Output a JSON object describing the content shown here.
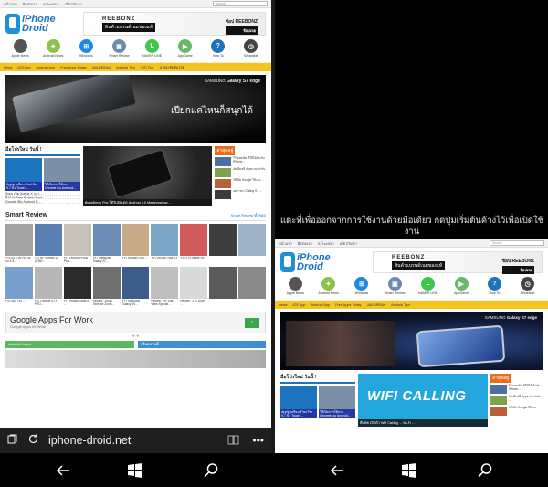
{
  "left_page": {
    "topbar": {
      "links": [
        "หน้าแรก",
        "ติดต่อเรา",
        "ลงโฆษณา",
        "เกี่ยวกับเรา"
      ],
      "search_placeholder": "Search"
    },
    "logo": {
      "line1": "iPhone",
      "line2": "Droid"
    },
    "banner": {
      "brand": "REEBONZ",
      "tagline": "สินค้าแบรนด์เนมของแท้",
      "cta_top": "ช้อป REEBONZ",
      "cta_bottom": "ช้อปเลย"
    },
    "categories": [
      {
        "label": "Apple News",
        "glyph": "",
        "color": "#555555"
      },
      {
        "label": "Android News",
        "glyph": "✦",
        "color": "#8bc34a"
      },
      {
        "label": "Windows",
        "glyph": "⊞",
        "color": "#1e88e5"
      },
      {
        "label": "Smart Review",
        "glyph": "▣",
        "color": "#6b8caf"
      },
      {
        "label": "NAVER LINE",
        "glyph": "L",
        "color": "#3ec74a"
      },
      {
        "label": "AppGame",
        "glyph": "▶",
        "color": "#66bb6a"
      },
      {
        "label": "How To",
        "glyph": "?",
        "color": "#1e73be"
      },
      {
        "label": "Wearable",
        "glyph": "◷",
        "color": "#444444"
      }
    ],
    "ticker": [
      "News",
      "iOS App",
      "Android App",
      "Free Apps Today",
      "JAILBREAK",
      "Android Tips",
      "iOS Tips",
      "อาจจะทิพย์พาสต์"
    ],
    "hero": {
      "label_brand": "SAMSUNG",
      "label_model": "Galaxy S7 edge",
      "slogan": "เปียกแค่ไหนก็สนุกได้"
    },
    "left_section": {
      "title": "มือโปรใหม่ วันนี้ !",
      "thumb1_caption": "Apple เตรียม iPad Pro 9.7 นิ้ว Touch ...",
      "thumb2_caption": "วิธีเปิดการใช้งาน Chrome บน Android...",
      "lines": [
        "Sony เปิด Xperia X แล้ว ...",
        "ดีลโปร Free Protein Pack...",
        "Google เปิด Android N ..."
      ]
    },
    "feature_caption": "BlackBerry Priv ได้รับอัพเดต Android 6.0 Marshmallow ...",
    "latest": {
      "title": "ล่าสุดอยู่",
      "items": [
        "รีวิวเทคนิค ที่ใช้ได้จริงกับ iPhone...",
        "จัดเต็มฟรี Apps ประจำวัน ...",
        "วิธีเปิด Google ใช้งาน ...",
        "เผยราคา Galaxy S7 ..."
      ]
    },
    "smart_review": {
      "title": "Smart Review",
      "more": "Smart Review ทั้งหมด",
      "row1": [
        "รีวิว ASTON Pro 45 จอ 4.5...",
        "รีวิว HP Stream 11 (X360 ...",
        "รีวิว Lenovo PHAB Plus...",
        "รีวิว Samsung Galaxy S7...",
        "รีวิว Huawei GR5 ...",
        "รีวิว Lenovo Vibe X3 ...",
        "รีวิว ZTE Blade V6 ...",
        "",
        ""
      ],
      "row2": [
        "รีวิว vivo Y51 ...",
        "รีวิว i-mobile IQ X PRO...",
        "รีวิว Huawei Mate 8 ...",
        "Review : ASUS Zenfone Zoom...",
        "รีวิว Samsung Galaxy A9...",
        "Review : HP Star Wars Special...",
        "Review : ZTE Axon ...",
        "",
        ""
      ]
    },
    "ad": {
      "headline": "Google Apps For Work",
      "sub": "Google Apps for Work"
    },
    "bottom_bars": [
      "Android News",
      "ฟรีแอปวันนี้"
    ],
    "address_bar": {
      "url": "iphone-droid.net"
    }
  },
  "right_pane": {
    "hint": "แตะที่เพื่อออกจากการใช้งานด้วยมือเดียว กดปุ่มเริ่มต้นค้างไว้เพื่อเปิดใช้งาน",
    "hero": {
      "label_brand": "SAMSUNG",
      "label_model": "Galaxy S7 edge"
    },
    "feature": {
      "text": "WIFI CALLING",
      "caption": "ดีแทค เปิดตัว Wifi Calling ... Wi-Fi ..."
    }
  },
  "colors": {
    "ticker": "#f6c51d",
    "accent_blue": "#1e73be",
    "latest_orange": "#e86d1f",
    "wifi_blue": "#22a6dc"
  },
  "icons": {
    "tabs": "tabs-icon",
    "refresh": "refresh-icon",
    "reading": "reading-view-icon",
    "more": "more-icon",
    "back": "back-icon",
    "windows": "windows-start-icon",
    "search": "search-icon"
  }
}
